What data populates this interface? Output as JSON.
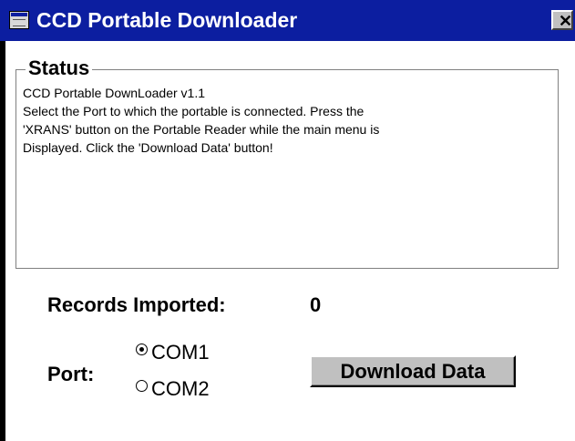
{
  "window": {
    "title": "CCD Portable Downloader",
    "title_icon": "app-window-icon",
    "close_label": "✕",
    "titlebar_color": "#0c1ea0"
  },
  "status": {
    "legend": "Status",
    "lines": [
      "CCD Portable DownLoader v1.1",
      "Select the Port to which the portable is connected. Press the",
      "'XRANS' button on the Portable Reader while the main menu is",
      "Displayed. Click the 'Download Data' button!"
    ]
  },
  "records": {
    "label": "Records Imported:",
    "value": "0"
  },
  "port": {
    "label": "Port:",
    "options": [
      {
        "label": "COM1",
        "selected": true
      },
      {
        "label": "COM2",
        "selected": false
      }
    ]
  },
  "actions": {
    "download_label": "Download Data"
  }
}
